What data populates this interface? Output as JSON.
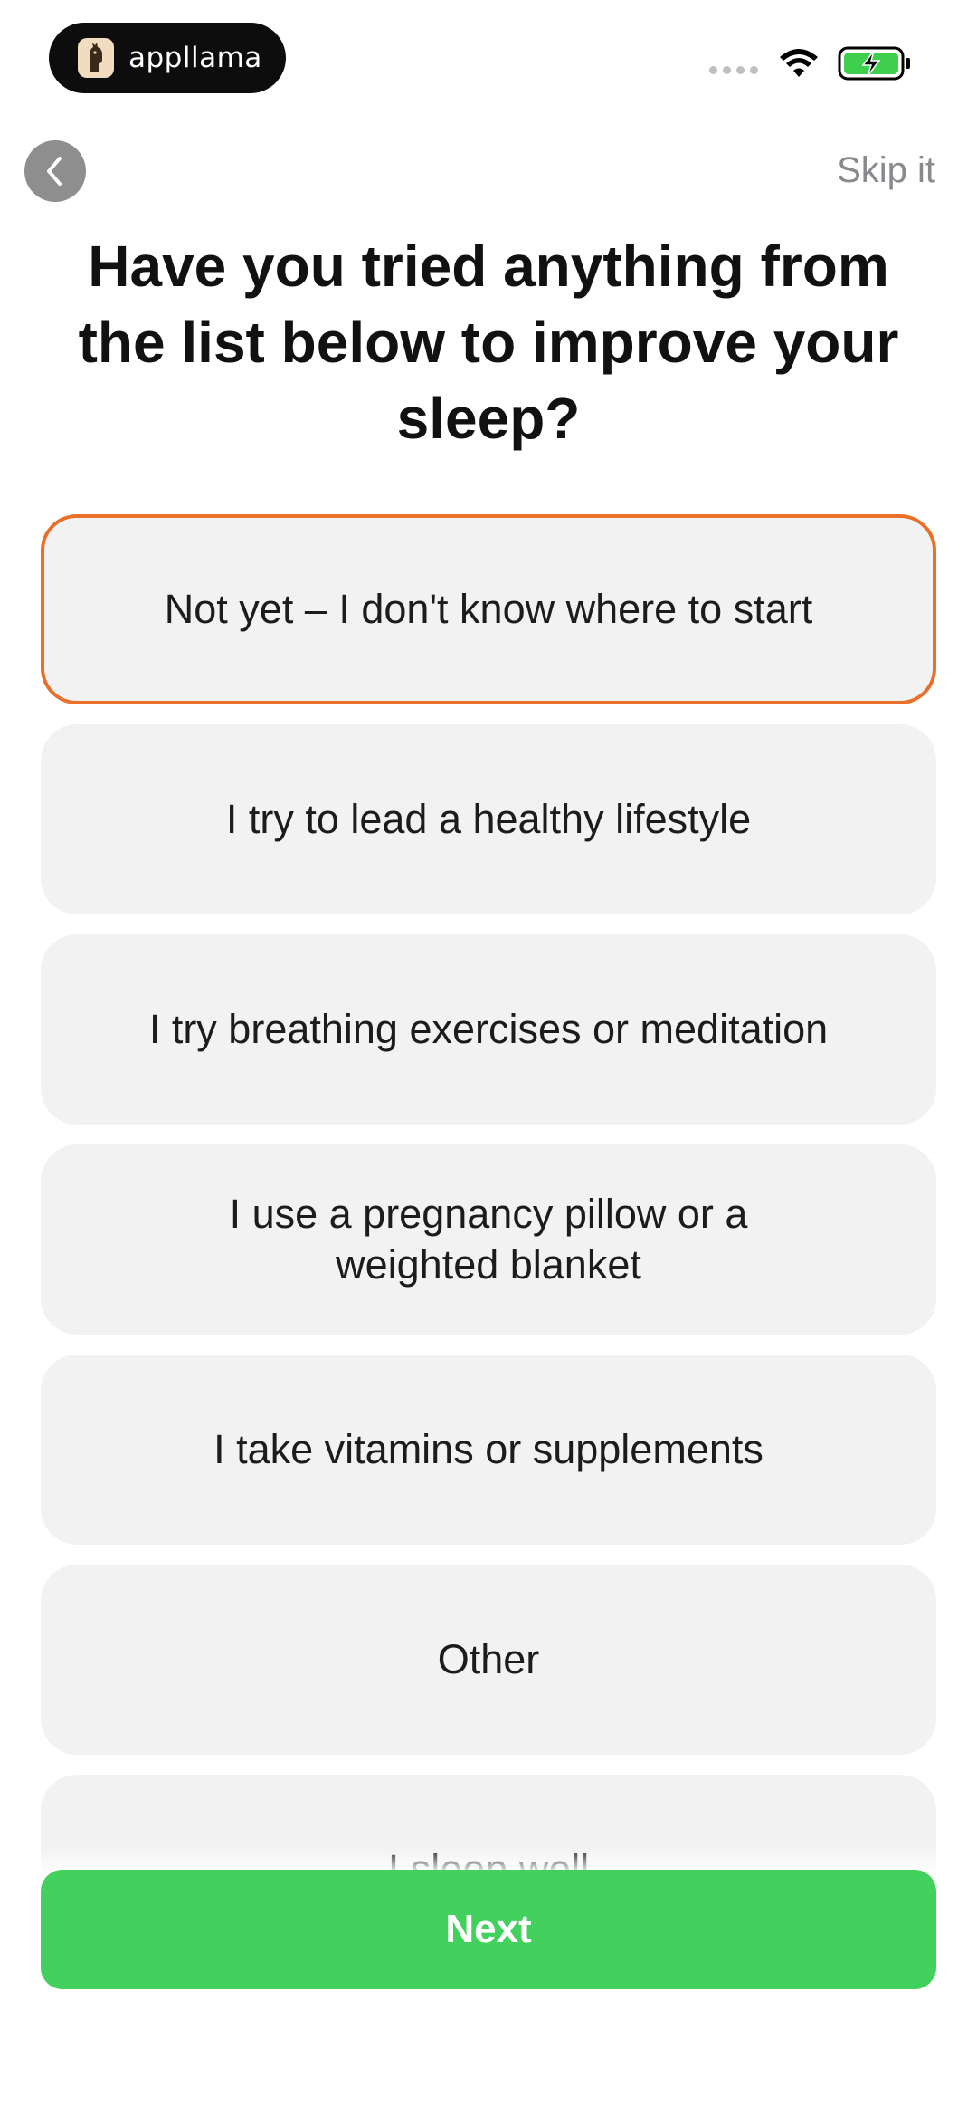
{
  "status_bar": {
    "app_name": "appllama",
    "icons": [
      "cellular-signal-icon",
      "wifi-icon",
      "battery-charging-icon"
    ],
    "battery_color": "#3ecf4c"
  },
  "nav": {
    "back_icon": "chevron-left-icon",
    "skip_label": "Skip it"
  },
  "title": "Have you tried anything from the list below to improve your sleep?",
  "options": [
    {
      "label": "Not yet – I don't know where to start",
      "selected": true
    },
    {
      "label": "I try to lead a healthy lifestyle",
      "selected": false
    },
    {
      "label": "I try breathing exercises or meditation",
      "selected": false
    },
    {
      "label": "I use a pregnancy pillow or a weighted blanket",
      "selected": false
    },
    {
      "label": "I take vitamins or supplements",
      "selected": false
    },
    {
      "label": "Other",
      "selected": false
    },
    {
      "label": "I sleep well",
      "selected": false
    }
  ],
  "next_label": "Next",
  "colors": {
    "accent_selected_border": "#e8702a",
    "next_button": "#43d15d",
    "option_background": "#f2f2f2"
  }
}
